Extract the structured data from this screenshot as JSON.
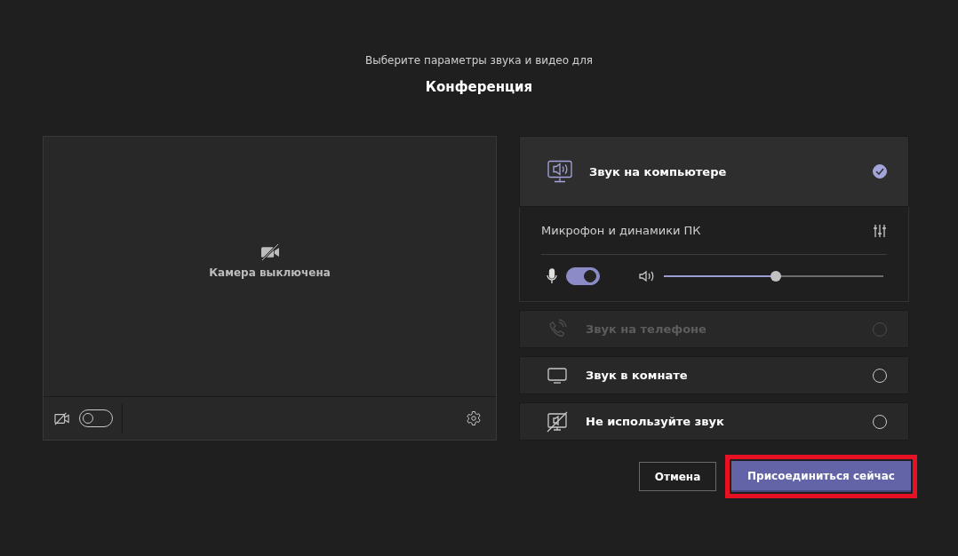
{
  "header": {
    "subtitle": "Выберите параметры звука и видео для",
    "title": "Конференция"
  },
  "preview": {
    "status": "Камера выключена",
    "camera_on": false
  },
  "audio_options": [
    {
      "kind": "computer",
      "label": "Звук на компьютере",
      "selected": true,
      "disabled": false
    },
    {
      "kind": "phone",
      "label": "Звук на телефоне",
      "selected": false,
      "disabled": true
    },
    {
      "kind": "room",
      "label": "Звук в комнате",
      "selected": false,
      "disabled": false
    },
    {
      "kind": "none",
      "label": "Не используйте звук",
      "selected": false,
      "disabled": false
    }
  ],
  "device": {
    "name": "Микрофон и динамики ПК",
    "mic_on": true,
    "volume": {
      "level": 0.51
    }
  },
  "buttons": [
    {
      "kind": "secondary",
      "label": "Отмена",
      "highlighted": false
    },
    {
      "kind": "primary",
      "label": "Присоединиться сейчас",
      "highlighted": true
    }
  ]
}
